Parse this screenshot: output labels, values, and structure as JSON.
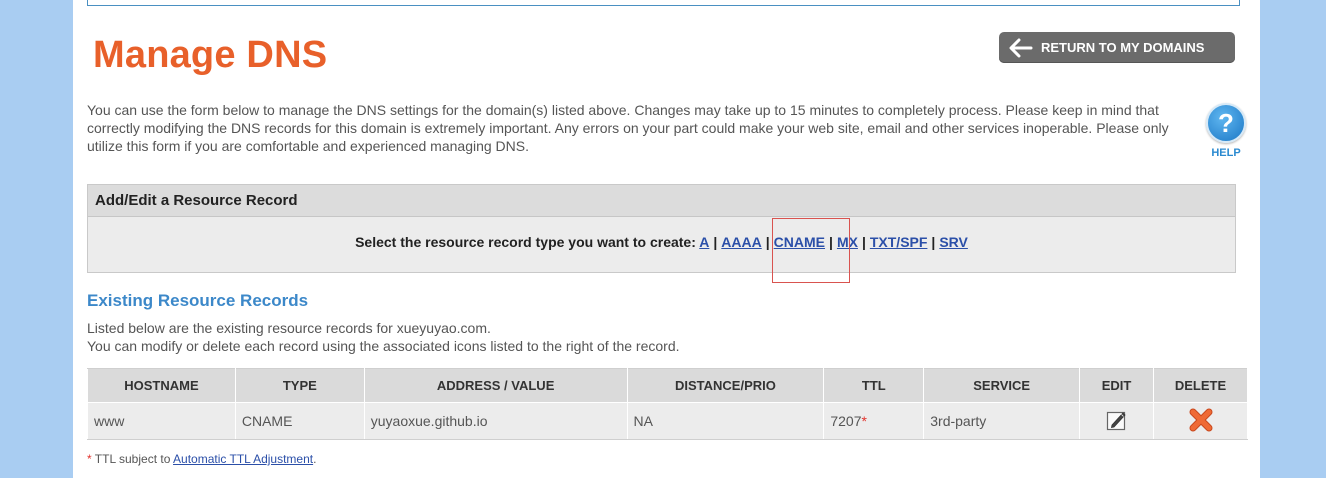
{
  "header": {
    "title": "Manage DNS",
    "return_label": "RETURN TO MY DOMAINS"
  },
  "intro_text": "You can use the form below to manage the DNS settings for the domain(s) listed above. Changes may take up to 15 minutes to completely process. Please keep in mind that correctly modifying the DNS records for this domain is extremely important. Any errors on your part could make your web site, email and other services inoperable. Please only utilize this form if you are comfortable and experienced managing DNS.",
  "help": {
    "icon_glyph": "?",
    "label": "HELP"
  },
  "add_edit": {
    "heading": "Add/Edit a Resource Record",
    "prompt": "Select the resource record type you want to create:",
    "types": [
      "A",
      "AAAA",
      "CNAME",
      "MX",
      "TXT/SPF",
      "SRV"
    ],
    "separator": "|"
  },
  "existing": {
    "heading": "Existing Resource Records",
    "line1": "Listed below are the existing resource records for xueyuyao.com.",
    "line2": "You can modify or delete each record using the associated icons listed to the right of the record."
  },
  "table": {
    "columns": [
      "HOSTNAME",
      "TYPE",
      "ADDRESS / VALUE",
      "DISTANCE/PRIO",
      "TTL",
      "SERVICE",
      "EDIT",
      "DELETE"
    ],
    "rows": [
      {
        "hostname": "www",
        "type": "CNAME",
        "address": "yuyaoxue.github.io",
        "distance": "NA",
        "ttl": "7207",
        "ttl_mark": "*",
        "service": "3rd-party"
      }
    ]
  },
  "footnote": {
    "mark": "*",
    "text": " TTL subject to ",
    "link": "Automatic TTL Adjustment",
    "end": "."
  },
  "icons": {
    "return": "arrow-left-icon",
    "help": "help-icon",
    "edit": "edit-pencil-icon",
    "delete": "delete-x-icon"
  },
  "colors": {
    "title": "#e8602a",
    "section_title": "#3c88c9",
    "link": "#2b4fa8",
    "delete": "#e8602a",
    "highlight": "#d9534f",
    "page_bg": "#a9cdf2"
  }
}
